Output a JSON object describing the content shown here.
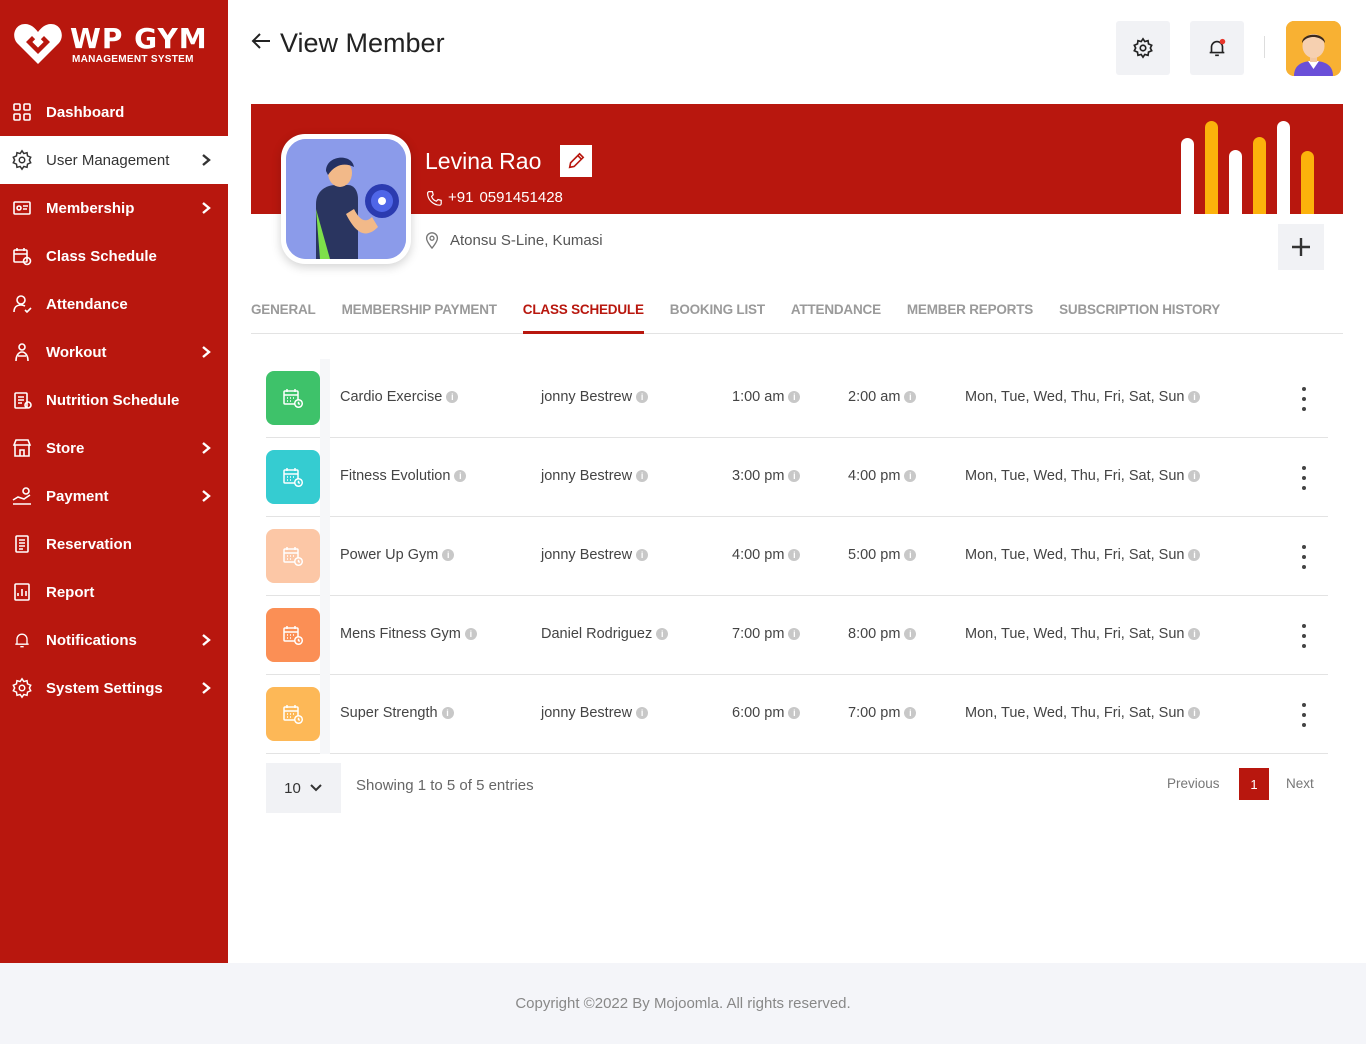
{
  "brand": {
    "title": "WP GYM",
    "subtitle": "MANAGEMENT SYSTEM"
  },
  "sidebar": {
    "items": [
      {
        "label": "Dashboard",
        "icon": "dashboard-icon",
        "chevron": false,
        "active": false
      },
      {
        "label": "User Management",
        "icon": "users-gear-icon",
        "chevron": true,
        "active": true
      },
      {
        "label": "Membership",
        "icon": "membership-card-icon",
        "chevron": true,
        "active": false
      },
      {
        "label": "Class Schedule",
        "icon": "calendar-icon",
        "chevron": false,
        "active": false
      },
      {
        "label": "Attendance",
        "icon": "user-check-icon",
        "chevron": false,
        "active": false
      },
      {
        "label": "Workout",
        "icon": "workout-icon",
        "chevron": true,
        "active": false
      },
      {
        "label": "Nutrition Schedule",
        "icon": "nutrition-icon",
        "chevron": false,
        "active": false
      },
      {
        "label": "Store",
        "icon": "store-icon",
        "chevron": true,
        "active": false
      },
      {
        "label": "Payment",
        "icon": "payment-icon",
        "chevron": true,
        "active": false
      },
      {
        "label": "Reservation",
        "icon": "reservation-icon",
        "chevron": false,
        "active": false
      },
      {
        "label": "Report",
        "icon": "report-icon",
        "chevron": false,
        "active": false
      },
      {
        "label": "Notifications",
        "icon": "bell-icon",
        "chevron": true,
        "active": false
      },
      {
        "label": "System Settings",
        "icon": "gear-icon",
        "chevron": true,
        "active": false
      }
    ]
  },
  "header": {
    "title": "View Member"
  },
  "member": {
    "name": "Levina Rao",
    "phone_code": "+91",
    "phone": "0591451428",
    "address": "Atonsu S-Line, Kumasi"
  },
  "tabs": [
    {
      "label": "GENERAL",
      "active": false
    },
    {
      "label": "MEMBERSHIP PAYMENT",
      "active": false
    },
    {
      "label": "CLASS SCHEDULE",
      "active": true
    },
    {
      "label": "BOOKING LIST",
      "active": false
    },
    {
      "label": "ATTENDANCE",
      "active": false
    },
    {
      "label": "MEMBER REPORTS",
      "active": false
    },
    {
      "label": "SUBSCRIPTION HISTORY",
      "active": false
    }
  ],
  "classes": [
    {
      "name": "Cardio Exercise",
      "trainer": "jonny Bestrew",
      "start": "1:00 am",
      "end": "2:00 am",
      "days": "Mon, Tue, Wed, Thu, Fri, Sat, Sun",
      "color": "#3ec26a"
    },
    {
      "name": "Fitness Evolution",
      "trainer": "jonny Bestrew",
      "start": "3:00 pm",
      "end": "4:00 pm",
      "days": "Mon, Tue, Wed, Thu, Fri, Sat, Sun",
      "color": "#35ccd1"
    },
    {
      "name": "Power Up Gym",
      "trainer": "jonny Bestrew",
      "start": "4:00 pm",
      "end": "5:00 pm",
      "days": "Mon, Tue, Wed, Thu, Fri, Sat, Sun",
      "color": "#fcc7a6"
    },
    {
      "name": "Mens Fitness Gym",
      "trainer": "Daniel Rodriguez",
      "start": "7:00 pm",
      "end": "8:00 pm",
      "days": "Mon, Tue, Wed, Thu, Fri, Sat, Sun",
      "color": "#fb8f55"
    },
    {
      "name": "Super Strength",
      "trainer": "jonny Bestrew",
      "start": "6:00 pm",
      "end": "7:00 pm",
      "days": "Mon, Tue, Wed, Thu, Fri, Sat, Sun",
      "color": "#fdb857"
    }
  ],
  "pagination": {
    "page_size": "10",
    "entries_text": "Showing 1 to 5 of 5 entries",
    "previous": "Previous",
    "current_page": "1",
    "next": "Next"
  },
  "footer": {
    "copyright": "Copyright ©2022 By Mojoomla. All rights reserved."
  },
  "colors": {
    "primary": "#b8170e",
    "accent_yellow": "#fcb20b",
    "bar_white": "#ffffff"
  }
}
